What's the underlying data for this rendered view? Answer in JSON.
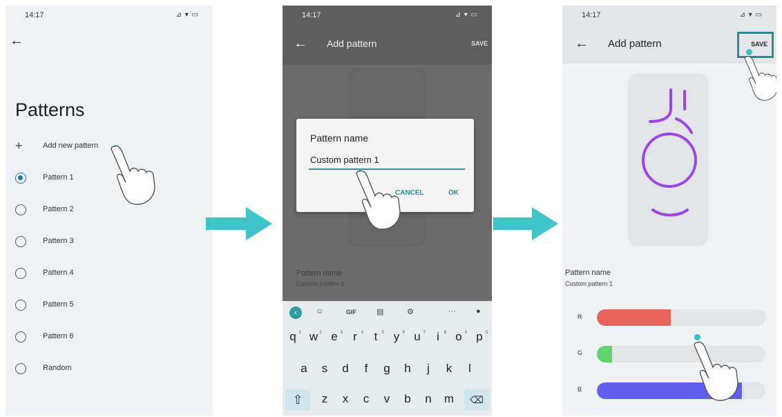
{
  "screen1": {
    "status": {
      "time": "14:17",
      "icons": "⊿ ▾ ▭"
    },
    "title": "Patterns",
    "add_label": "Add new pattern",
    "options": [
      {
        "label": "Pattern 1",
        "selected": true
      },
      {
        "label": "Pattern 2",
        "selected": false
      },
      {
        "label": "Pattern 3",
        "selected": false
      },
      {
        "label": "Pattern 4",
        "selected": false
      },
      {
        "label": "Pattern 5",
        "selected": false
      },
      {
        "label": "Pattern 6",
        "selected": false
      },
      {
        "label": "Random",
        "selected": false
      }
    ]
  },
  "screen2": {
    "status": {
      "time": "14:17",
      "icons": "⊿ ▾ ▭"
    },
    "title": "Add pattern",
    "save_label": "SAVE",
    "dialog": {
      "title": "Pattern name",
      "value": "Custom pattern 1",
      "cancel_label": "CANCEL",
      "ok_label": "OK"
    },
    "field_label": "Pattern name",
    "field_value": "Custom pattern 1",
    "keyboard": {
      "toolbar": [
        "GIF",
        "···"
      ],
      "row1": [
        "q",
        "w",
        "e",
        "r",
        "t",
        "y",
        "u",
        "i",
        "o",
        "p"
      ],
      "row1_hints": [
        "1",
        "2",
        "3",
        "4",
        "5",
        "6",
        "7",
        "8",
        "9",
        "0"
      ],
      "row2": [
        "a",
        "s",
        "d",
        "f",
        "g",
        "h",
        "j",
        "k",
        "l"
      ],
      "row3": [
        "z",
        "x",
        "c",
        "v",
        "b",
        "n",
        "m"
      ]
    }
  },
  "screen3": {
    "status": {
      "time": "14:17",
      "icons": "⊿ ▾ ▭"
    },
    "title": "Add pattern",
    "save_label": "SAVE",
    "field_label": "Pattern name",
    "field_value": "Custom pattern 1",
    "sliders": [
      {
        "label": "R",
        "fraction": 0.44,
        "color": "#e8635b"
      },
      {
        "label": "G",
        "fraction": 0.09,
        "color": "#5fd36e"
      },
      {
        "label": "B",
        "fraction": 0.86,
        "color": "#5f5ff0"
      }
    ],
    "pattern_color": "#9b45e6"
  },
  "colors": {
    "accent": "#35c2c7",
    "arrow": "#3fc4c9"
  }
}
